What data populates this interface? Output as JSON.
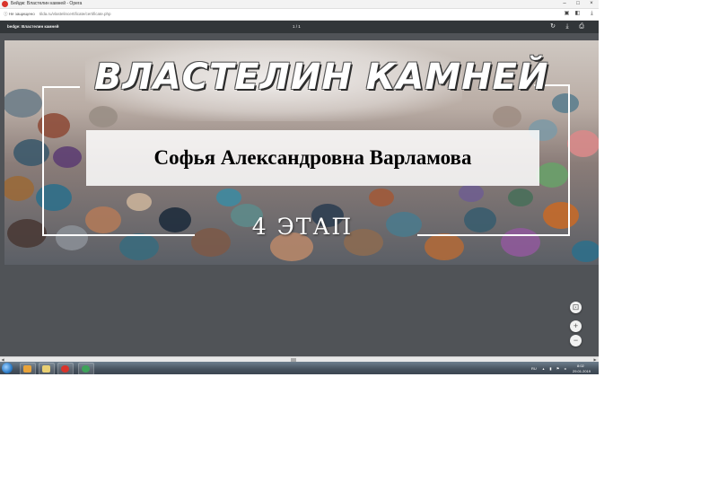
{
  "window": {
    "title": "Бейдж: Властелин камней - Opera",
    "minimize_icon": "minimize-icon",
    "maximize_icon": "maximize-icon",
    "close_icon": "close-icon"
  },
  "addressbar": {
    "security_label": "Не защищено",
    "url": "tilda.ru/vlastelincertificate/certificate.php"
  },
  "pdf_toolbar": {
    "doc_title": "bedge: Властелин камней",
    "page_count": "1 / 1"
  },
  "certificate": {
    "heading": "ВЛАСТЕЛИН КАМНЕЙ",
    "name": "Софья Александровна Варламова",
    "stage": "4 ЭТАП"
  },
  "zoom": {
    "fit_label": "⊡",
    "zoom_in_label": "+",
    "zoom_out_label": "−"
  },
  "tray": {
    "lang": "RU",
    "time": "8:02",
    "date": "29.01.2019"
  },
  "colors": {
    "viewer_background": "#505357",
    "toolbar": "#323639",
    "accent": "#d9342b"
  }
}
